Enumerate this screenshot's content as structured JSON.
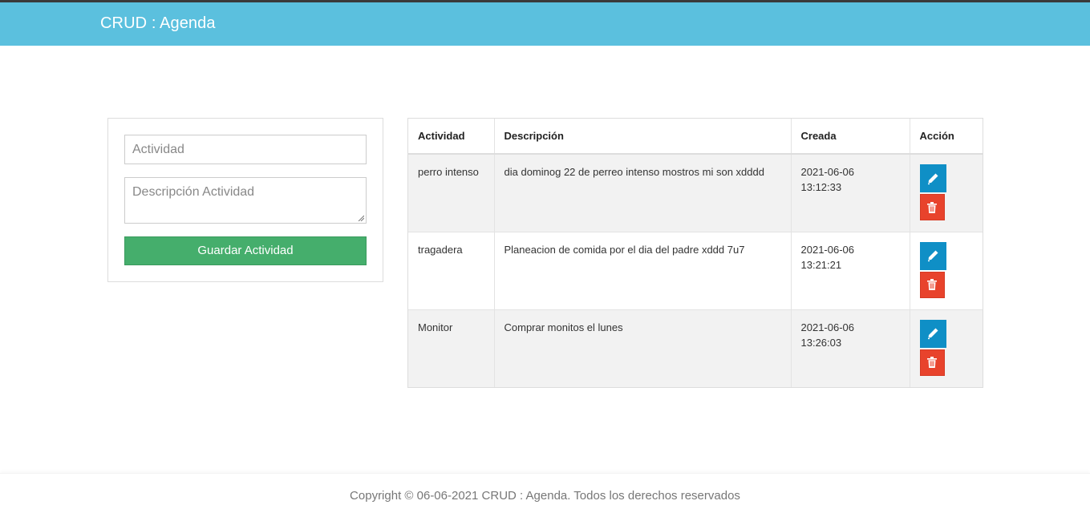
{
  "header": {
    "brand": "CRUD : Agenda"
  },
  "form": {
    "activity_placeholder": "Actividad",
    "description_placeholder": "Descripción Actividad",
    "save_label": "Guardar Actividad"
  },
  "table": {
    "headers": [
      "Actividad",
      "Descripción",
      "Creada",
      "Acción"
    ],
    "rows": [
      {
        "activity": "perro intenso",
        "description": "dia dominog 22 de perreo intenso mostros mi son xdddd",
        "created_date": "2021-06-06",
        "created_time": "13:12:33"
      },
      {
        "activity": "tragadera",
        "description": "Planeacion de comida por el dia del padre xddd 7u7",
        "created_date": "2021-06-06",
        "created_time": "13:21:21"
      },
      {
        "activity": "Monitor",
        "description": "Comprar monitos el lunes",
        "created_date": "2021-06-06",
        "created_time": "13:26:03"
      }
    ]
  },
  "footer": {
    "text": "Copyright © 06-06-2021 CRUD : Agenda. Todos los derechos reservados"
  },
  "colors": {
    "navbar": "#5bc0de",
    "save": "#45ae6c",
    "edit": "#0f8fc6",
    "delete": "#e8432c"
  },
  "icons": {
    "edit": "pencil-icon",
    "delete": "trash-icon"
  }
}
